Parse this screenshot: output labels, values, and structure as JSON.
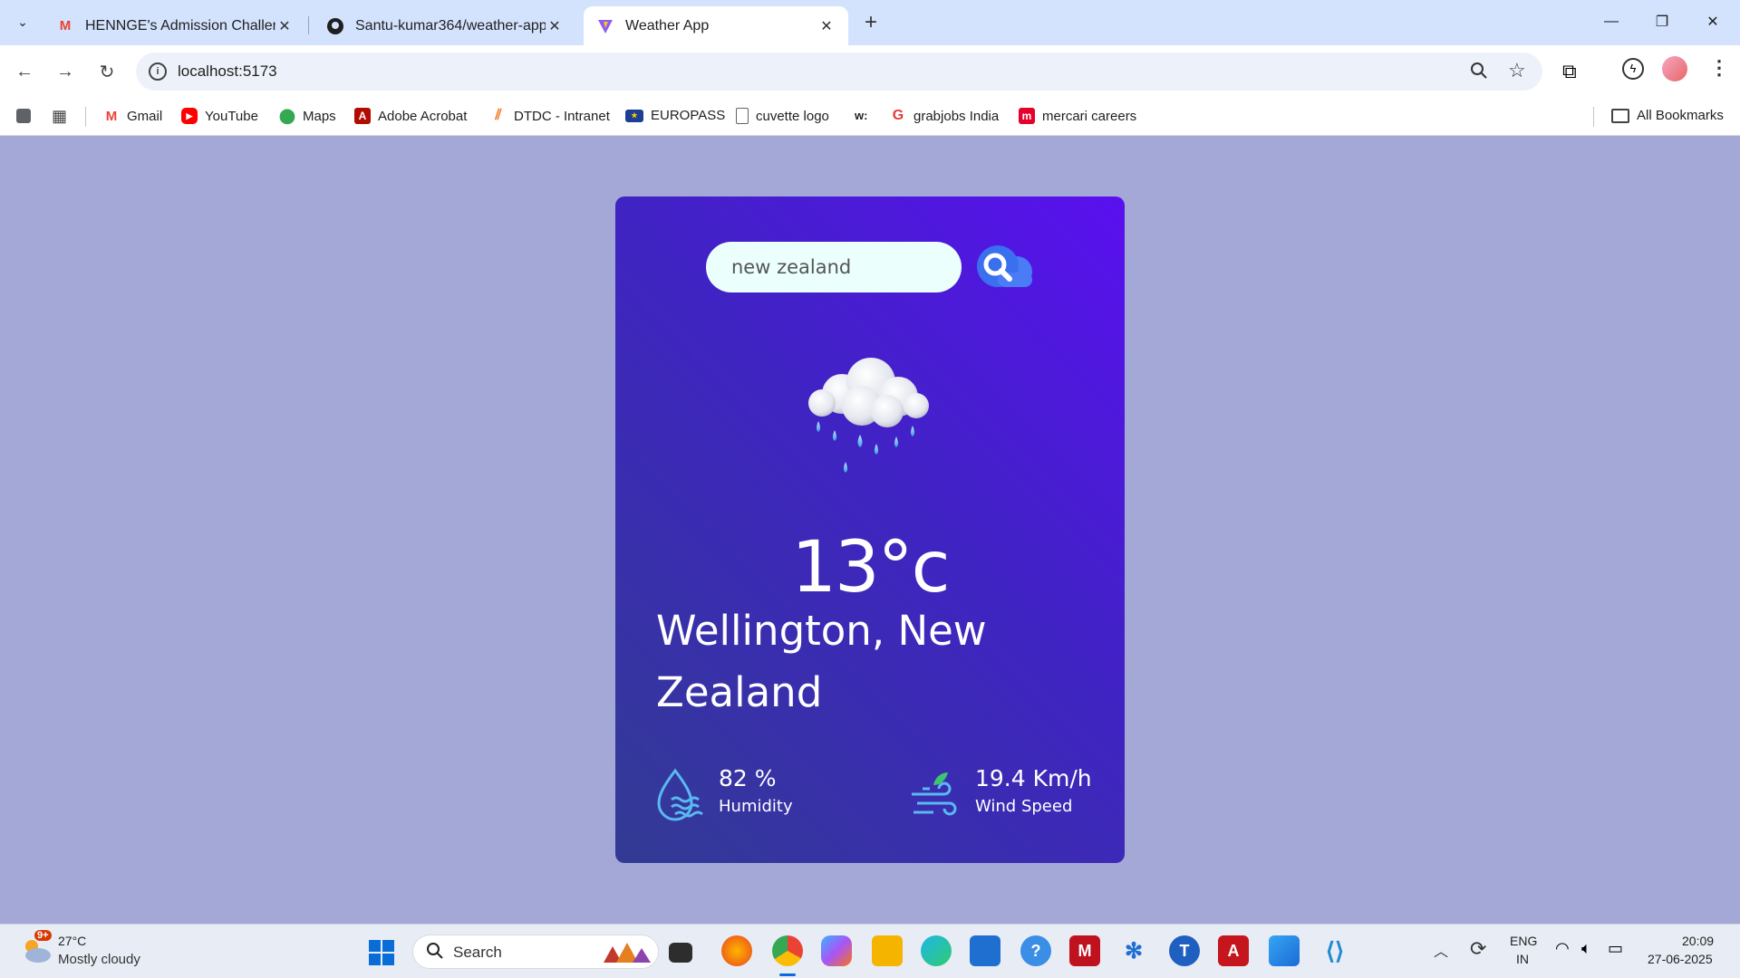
{
  "browser": {
    "tabs": [
      {
        "title": "HENNGE's Admission Challenge",
        "favicon": "gmail-icon"
      },
      {
        "title": "Santu-kumar364/weather-app:",
        "favicon": "github-icon"
      },
      {
        "title": "Weather App",
        "favicon": "vite-icon"
      }
    ],
    "url": "localhost:5173",
    "bookmarks": [
      {
        "label": "Gmail",
        "icon": "gmail-icon"
      },
      {
        "label": "YouTube",
        "icon": "youtube-icon"
      },
      {
        "label": "Maps",
        "icon": "maps-icon"
      },
      {
        "label": "Adobe Acrobat",
        "icon": "acrobat-icon"
      },
      {
        "label": "DTDC - Intranet",
        "icon": "dtdc-icon"
      },
      {
        "label": "EUROPASS",
        "icon": "eu-flag-icon"
      },
      {
        "label": "cuvette logo",
        "icon": "file-icon"
      },
      {
        "label": "grabjobs India",
        "icon": "grabjobs-icon"
      },
      {
        "label": "mercari careers",
        "icon": "mercari-icon"
      }
    ],
    "all_bookmarks": "All Bookmarks"
  },
  "app": {
    "search_value": "new zealand",
    "temperature": "13°c",
    "city": "Wellington, New Zealand",
    "humidity_value": "82 %",
    "humidity_label": "Humidity",
    "wind_value": "19.4 Km/h",
    "wind_label": "Wind Speed",
    "condition_icon": "rain-cloud-icon"
  },
  "taskbar": {
    "weather_badge": "9+",
    "weather_temp": "27°C",
    "weather_desc": "Mostly cloudy",
    "search_label": "Search",
    "lang_top": "ENG",
    "lang_bottom": "IN",
    "time": "20:09",
    "date": "27-06-2025"
  }
}
